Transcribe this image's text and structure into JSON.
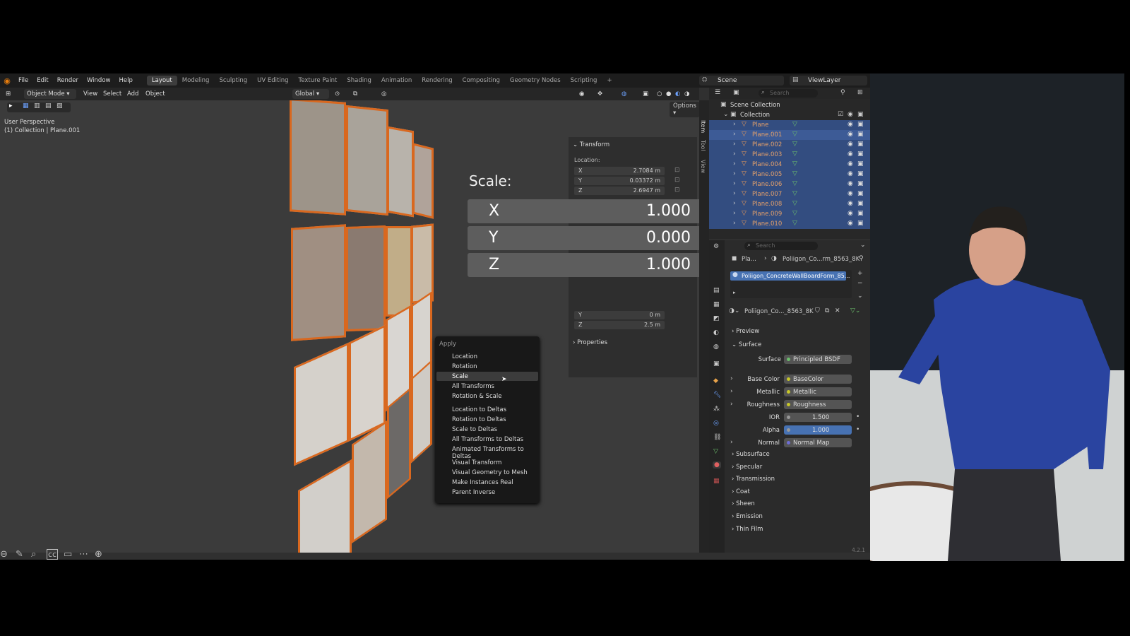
{
  "topbar": {
    "menus": [
      "File",
      "Edit",
      "Render",
      "Window",
      "Help"
    ],
    "workspaces": [
      "Layout",
      "Modeling",
      "Sculpting",
      "UV Editing",
      "Texture Paint",
      "Shading",
      "Animation",
      "Rendering",
      "Compositing",
      "Geometry Nodes",
      "Scripting"
    ],
    "active_workspace": "Layout",
    "plus": "+",
    "scene": "Scene",
    "view_layer": "ViewLayer"
  },
  "header": {
    "mode": "Object Mode",
    "menus": [
      "View",
      "Select",
      "Add",
      "Object"
    ],
    "orientation": "Global",
    "options": "Options"
  },
  "viewport": {
    "perspective": "User Perspective",
    "collection_info": "(1) Collection | Plane.001"
  },
  "npanel": {
    "tabs": [
      "Item",
      "Tool",
      "View"
    ],
    "transform_title": "Transform",
    "location_label": "Location:",
    "location": [
      {
        "axis": "X",
        "value": "2.7084 m"
      },
      {
        "axis": "Y",
        "value": "0.03372 m"
      },
      {
        "axis": "Z",
        "value": "2.6947 m"
      }
    ],
    "dimensions": [
      {
        "axis": "Y",
        "value": "0 m"
      },
      {
        "axis": "Z",
        "value": "2.5 m"
      }
    ],
    "properties_title": "Properties"
  },
  "scale_popup": {
    "title": "Scale:",
    "rows": [
      {
        "axis": "X",
        "value": "1.000"
      },
      {
        "axis": "Y",
        "value": "0.000"
      },
      {
        "axis": "Z",
        "value": "1.000"
      }
    ]
  },
  "apply_menu": {
    "title": "Apply",
    "group1": [
      "Location",
      "Rotation",
      "Scale",
      "All Transforms",
      "Rotation & Scale"
    ],
    "group2": [
      "Location to Deltas",
      "Rotation to Deltas",
      "Scale to Deltas",
      "All Transforms to Deltas",
      "Animated Transforms to Deltas"
    ],
    "group3": [
      "Visual Transform",
      "Visual Geometry to Mesh",
      "Make Instances Real",
      "Parent Inverse"
    ],
    "highlighted": "Scale"
  },
  "outliner": {
    "search_placeholder": "Search",
    "scene_collection": "Scene Collection",
    "collection": "Collection",
    "items": [
      "Plane",
      "Plane.001",
      "Plane.002",
      "Plane.003",
      "Plane.004",
      "Plane.005",
      "Plane.006",
      "Plane.007",
      "Plane.008",
      "Plane.009",
      "Plane.010"
    ]
  },
  "properties": {
    "search_placeholder": "Search",
    "breadcrumb_object": "Pla...",
    "breadcrumb_material": "Poliigon_Co...rm_8563_8K",
    "material_slot": "Poliigon_ConcreteWallBoardForm_85...",
    "material_name": "Poliigon_Co..._8563_8K",
    "sections_top": [
      "Preview",
      "Surface"
    ],
    "surface_label": "Surface",
    "surface_value": "Principled BSDF",
    "inputs": [
      {
        "label": "Base Color",
        "value": "BaseColor"
      },
      {
        "label": "Metallic",
        "value": "Metallic"
      },
      {
        "label": "Roughness",
        "value": "Roughness"
      },
      {
        "label": "IOR",
        "value": "1.500"
      },
      {
        "label": "Alpha",
        "value": "1.000"
      },
      {
        "label": "Normal",
        "value": "Normal Map"
      }
    ],
    "subsections": [
      "Subsurface",
      "Specular",
      "Transmission",
      "Coat",
      "Sheen",
      "Emission",
      "Thin Film"
    ],
    "version": "4.2.1"
  },
  "colors": {
    "accent_blue": "#4772b3",
    "selection_orange": "#d9681f",
    "outliner_highlight": "#334d80"
  }
}
